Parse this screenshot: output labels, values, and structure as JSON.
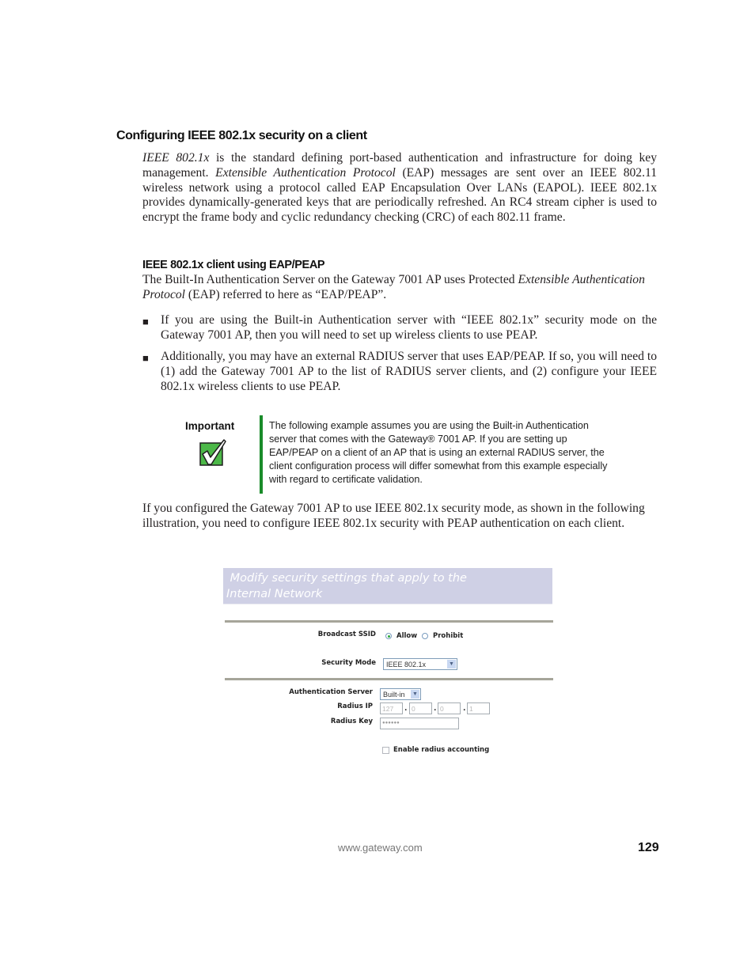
{
  "section": {
    "title": "Configuring IEEE 802.1x security on a client",
    "intro": {
      "term1": "IEEE 802.1x",
      "part1": " is the standard defining port-based authentication and infrastructure for doing key management. ",
      "term2": "Extensible Authentication Protocol",
      "part2": " (EAP) messages are sent over an IEEE 802.11 wireless network using a protocol called EAP Encapsulation Over LANs (EAPOL). IEEE 802.1x provides dynamically-generated keys that are periodically refreshed. An RC4 stream cipher is used to encrypt the frame body and cyclic redundancy checking (CRC) of each 802.11 frame."
    }
  },
  "subsection": {
    "title": "IEEE 802.1x client using EAP/PEAP",
    "para_part1": "The Built-In Authentication Server on the Gateway 7001 AP uses Protected ",
    "para_term": "Extensible Authentication Protocol",
    "para_part2": " (EAP) referred to here as “EAP/PEAP”.",
    "bullets": [
      "If you are using the Built-in Authentication server with “IEEE 802.1x” security mode on the Gateway 7001 AP, then you will need to set up wireless clients to use PEAP.",
      "Additionally, you may have an external RADIUS server that uses EAP/PEAP. If so, you will need to (1) add the Gateway 7001 AP to the list of RADIUS server clients, and (2) configure your IEEE 802.1x wireless clients to use PEAP."
    ],
    "bullet_glyph": "■"
  },
  "important": {
    "label": "Important",
    "icon": "checkmark-icon",
    "text": "The following example assumes you are using the Built-in Authentication server that comes with the Gateway® 7001 AP. If you are setting up EAP/PEAP on a client of an AP that is using an external RADIUS server, the client configuration process will differ somewhat from this example especially with regard to certificate validation.",
    "bar_color": "#1a8c2a",
    "icon_color": "#4cb848"
  },
  "closing_paragraph": "If you configured the Gateway 7001 AP to use IEEE 802.1x security mode, as shown in the following illustration, you need to configure IEEE 802.1x security with PEAP authentication on each client.",
  "figure": {
    "banner": "Modify security settings that apply to the Internal Network",
    "banner_line1": " Modify security settings that apply to the",
    "banner_line2": "Internal Network",
    "broadcast_ssid": {
      "label": "Broadcast SSID",
      "options": [
        "Allow",
        "Prohibit"
      ],
      "selected": "Allow"
    },
    "security_mode": {
      "label": "Security Mode",
      "value": "IEEE 802.1x"
    },
    "authentication_server": {
      "label": "Authentication Server",
      "value": "Built-in"
    },
    "radius_ip": {
      "label": "Radius IP",
      "octets": [
        "127",
        "0",
        "0",
        "1"
      ]
    },
    "radius_key": {
      "label": "Radius Key",
      "value": "●●●●●●"
    },
    "accounting": {
      "label": "Enable radius accounting",
      "checked": false
    }
  },
  "footer": {
    "url": "www.gateway.com",
    "page_number": "129"
  }
}
